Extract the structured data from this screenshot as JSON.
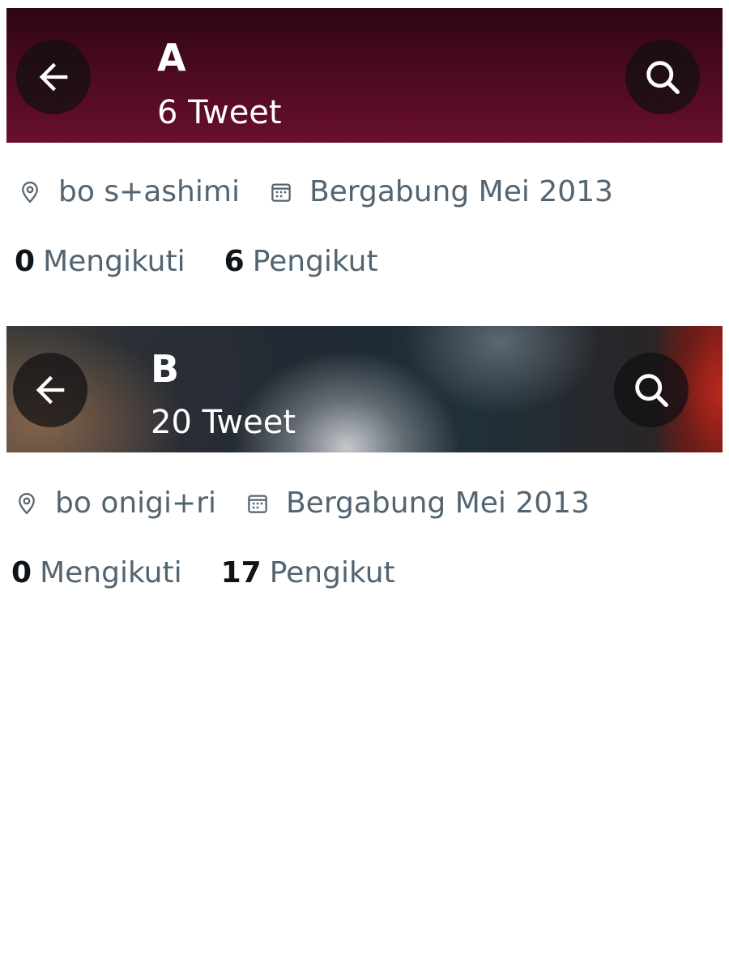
{
  "profiles": [
    {
      "name": "A",
      "tweet_count": "6 Tweet",
      "location": "bo s+ashimi",
      "joined": "Bergabung Mei 2013",
      "following_count": "0",
      "following_label": "Mengikuti",
      "followers_count": "6",
      "followers_label": "Pengikut",
      "banner_color": "#4a0a1e"
    },
    {
      "name": "B",
      "tweet_count": "20 Tweet",
      "location": "bo onigi+ri",
      "joined": "Bergabung Mei 2013",
      "following_count": "0",
      "following_label": "Mengikuti",
      "followers_count": "17",
      "followers_label": "Pengikut",
      "banner_color": "#20303a"
    }
  ],
  "icons": {
    "back": "arrow-left-icon",
    "search": "search-icon",
    "location": "location-pin-icon",
    "calendar": "calendar-icon"
  },
  "colors": {
    "secondary_text": "#536471",
    "primary_text": "#0f1419",
    "header_text": "#ffffff"
  }
}
